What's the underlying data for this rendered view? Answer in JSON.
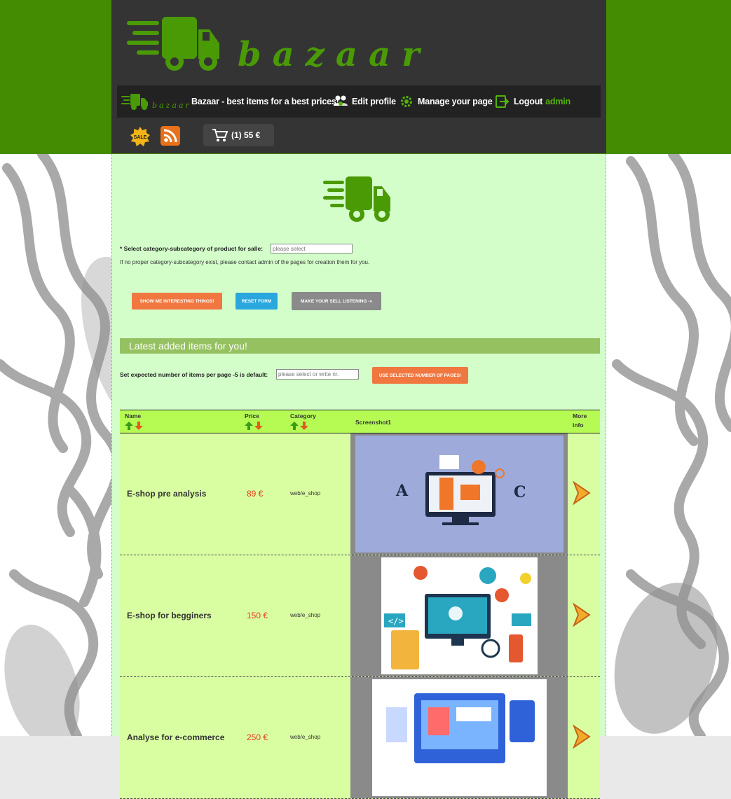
{
  "brand": {
    "logo_text": "bazaar",
    "mini_logo_text": "bazaar",
    "accent_color": "#448c02"
  },
  "nav": {
    "tagline": "Bazaar - best items for a best prices!",
    "edit_profile": "Edit profile",
    "manage_page": "Manage your page",
    "logout": "Logout",
    "user": "admin"
  },
  "toolbar": {
    "sale_badge": "SALE",
    "cart_text": "(1) 55 €"
  },
  "form": {
    "select_label": "* Select category-subcategory of product for salle:",
    "select_placeholder": "please select",
    "help_text": "If no proper category-subcategory exist, please contact admin of the pages for creation them for you.",
    "btn_interesting": "SHOW ME INTERESTING THINGS!",
    "btn_reset": "RESET FORM",
    "btn_sell": "MAKE YOUR SELL LISTENING -»"
  },
  "latest": {
    "title": "Latest added items for you!",
    "ipp_label": "Set expected number of items per page -5 is default:",
    "ipp_placeholder": "please select or write nr.",
    "ipp_button": "USE SELECTED NUMBER OF PAGES!"
  },
  "table": {
    "headers": {
      "name": "Name",
      "price": "Price",
      "category": "Category",
      "screenshot": "Screenshot1",
      "more_1": "More",
      "more_2": "info"
    },
    "rows": [
      {
        "name": "E-shop pre analysis",
        "price": "89 €",
        "category": "web/e_shop",
        "image_icon": "analytics-illustration"
      },
      {
        "name": "E-shop for begginers",
        "price": "150 €",
        "category": "web/e_shop",
        "image_icon": "web-development-illustration"
      },
      {
        "name": "Analyse for e-commerce",
        "price": "250 €",
        "category": "web/e_shop",
        "image_icon": "ecommerce-illustration"
      }
    ]
  }
}
